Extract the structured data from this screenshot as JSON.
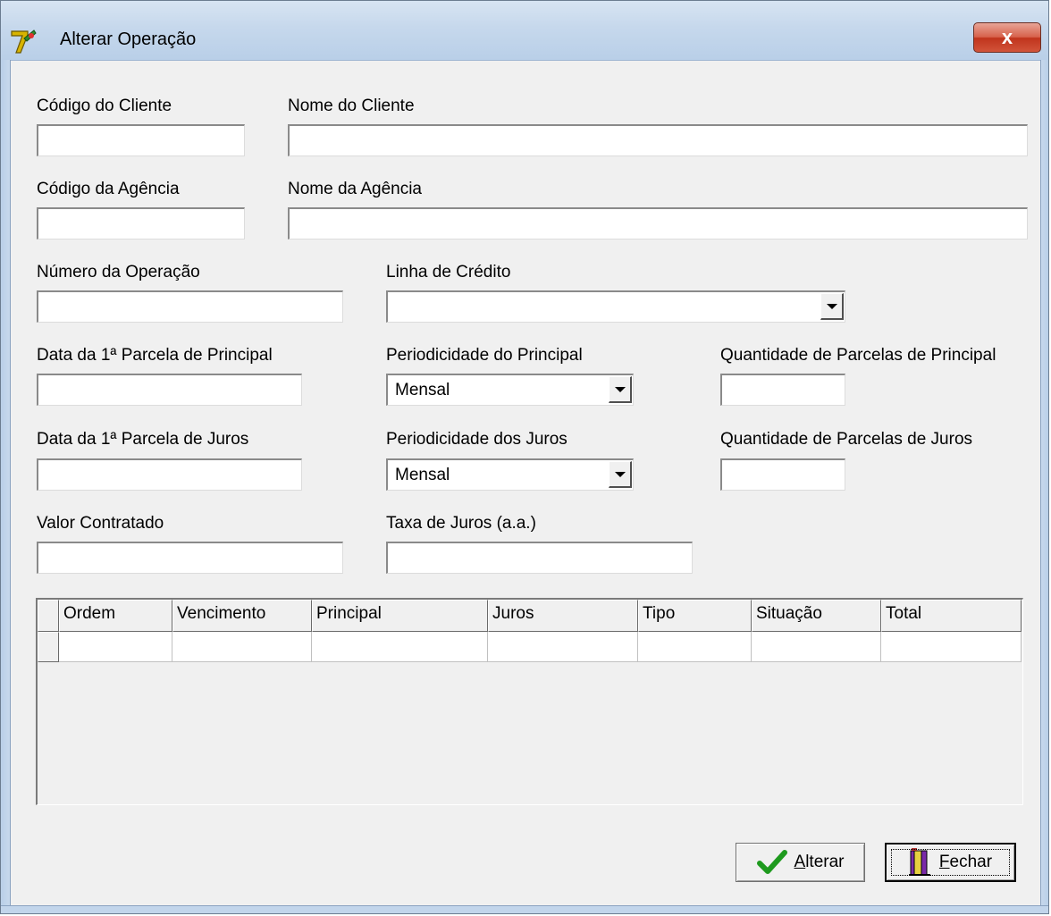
{
  "window": {
    "title": "Alterar Operação",
    "close_glyph": "x"
  },
  "fields": {
    "codigo_cliente": {
      "label": "Código do Cliente",
      "value": ""
    },
    "nome_cliente": {
      "label": "Nome do Cliente",
      "value": ""
    },
    "codigo_agencia": {
      "label": "Código da Agência",
      "value": ""
    },
    "nome_agencia": {
      "label": "Nome da Agência",
      "value": ""
    },
    "numero_operacao": {
      "label": "Número da Operação",
      "value": ""
    },
    "linha_credito": {
      "label": "Linha de Crédito",
      "value": ""
    },
    "data_parcela_principal": {
      "label": "Data da 1ª Parcela de Principal",
      "value": ""
    },
    "periodicidade_principal": {
      "label": "Periodicidade do Principal",
      "value": "Mensal"
    },
    "qtd_parcelas_principal": {
      "label": "Quantidade de Parcelas de Principal",
      "value": ""
    },
    "data_parcela_juros": {
      "label": "Data da 1ª Parcela de Juros",
      "value": ""
    },
    "periodicidade_juros": {
      "label": "Periodicidade dos Juros",
      "value": "Mensal"
    },
    "qtd_parcelas_juros": {
      "label": "Quantidade de Parcelas de Juros",
      "value": ""
    },
    "valor_contratado": {
      "label": "Valor Contratado",
      "value": ""
    },
    "taxa_juros": {
      "label": "Taxa de Juros (a.a.)",
      "value": ""
    }
  },
  "grid": {
    "columns": [
      "Ordem",
      "Vencimento",
      "Principal",
      "Juros",
      "Tipo",
      "Situação",
      "Total"
    ],
    "rows": [
      [
        "",
        "",
        "",
        "",
        "",
        "",
        ""
      ]
    ]
  },
  "buttons": {
    "alterar": {
      "accel": "A",
      "rest": "lterar",
      "icon": "checkmark-icon"
    },
    "fechar": {
      "accel": "F",
      "rest": "echar",
      "icon": "door-exit-icon"
    }
  },
  "colors": {
    "title_gradient": "#c6d8ec",
    "close_button": "#c0341c",
    "check_green": "#1e9a1e"
  }
}
